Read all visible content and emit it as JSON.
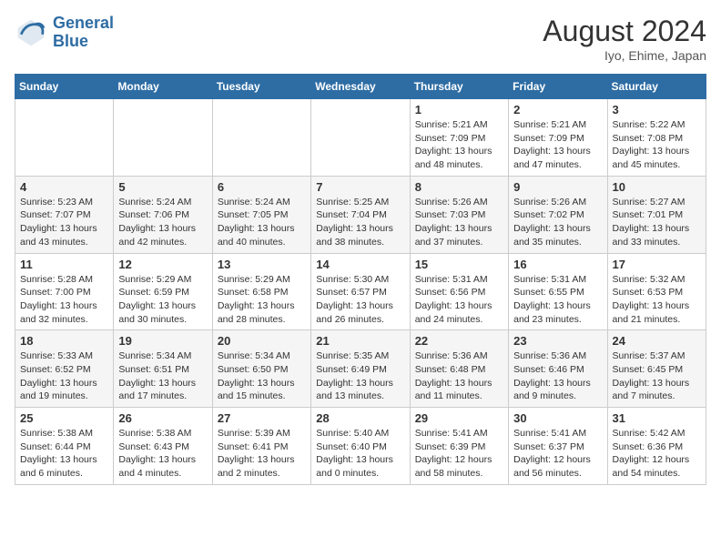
{
  "header": {
    "logo_line1": "General",
    "logo_line2": "Blue",
    "month": "August 2024",
    "location": "Iyo, Ehime, Japan"
  },
  "weekdays": [
    "Sunday",
    "Monday",
    "Tuesday",
    "Wednesday",
    "Thursday",
    "Friday",
    "Saturday"
  ],
  "weeks": [
    [
      {
        "day": "",
        "info": ""
      },
      {
        "day": "",
        "info": ""
      },
      {
        "day": "",
        "info": ""
      },
      {
        "day": "",
        "info": ""
      },
      {
        "day": "1",
        "info": "Sunrise: 5:21 AM\nSunset: 7:09 PM\nDaylight: 13 hours\nand 48 minutes."
      },
      {
        "day": "2",
        "info": "Sunrise: 5:21 AM\nSunset: 7:09 PM\nDaylight: 13 hours\nand 47 minutes."
      },
      {
        "day": "3",
        "info": "Sunrise: 5:22 AM\nSunset: 7:08 PM\nDaylight: 13 hours\nand 45 minutes."
      }
    ],
    [
      {
        "day": "4",
        "info": "Sunrise: 5:23 AM\nSunset: 7:07 PM\nDaylight: 13 hours\nand 43 minutes."
      },
      {
        "day": "5",
        "info": "Sunrise: 5:24 AM\nSunset: 7:06 PM\nDaylight: 13 hours\nand 42 minutes."
      },
      {
        "day": "6",
        "info": "Sunrise: 5:24 AM\nSunset: 7:05 PM\nDaylight: 13 hours\nand 40 minutes."
      },
      {
        "day": "7",
        "info": "Sunrise: 5:25 AM\nSunset: 7:04 PM\nDaylight: 13 hours\nand 38 minutes."
      },
      {
        "day": "8",
        "info": "Sunrise: 5:26 AM\nSunset: 7:03 PM\nDaylight: 13 hours\nand 37 minutes."
      },
      {
        "day": "9",
        "info": "Sunrise: 5:26 AM\nSunset: 7:02 PM\nDaylight: 13 hours\nand 35 minutes."
      },
      {
        "day": "10",
        "info": "Sunrise: 5:27 AM\nSunset: 7:01 PM\nDaylight: 13 hours\nand 33 minutes."
      }
    ],
    [
      {
        "day": "11",
        "info": "Sunrise: 5:28 AM\nSunset: 7:00 PM\nDaylight: 13 hours\nand 32 minutes."
      },
      {
        "day": "12",
        "info": "Sunrise: 5:29 AM\nSunset: 6:59 PM\nDaylight: 13 hours\nand 30 minutes."
      },
      {
        "day": "13",
        "info": "Sunrise: 5:29 AM\nSunset: 6:58 PM\nDaylight: 13 hours\nand 28 minutes."
      },
      {
        "day": "14",
        "info": "Sunrise: 5:30 AM\nSunset: 6:57 PM\nDaylight: 13 hours\nand 26 minutes."
      },
      {
        "day": "15",
        "info": "Sunrise: 5:31 AM\nSunset: 6:56 PM\nDaylight: 13 hours\nand 24 minutes."
      },
      {
        "day": "16",
        "info": "Sunrise: 5:31 AM\nSunset: 6:55 PM\nDaylight: 13 hours\nand 23 minutes."
      },
      {
        "day": "17",
        "info": "Sunrise: 5:32 AM\nSunset: 6:53 PM\nDaylight: 13 hours\nand 21 minutes."
      }
    ],
    [
      {
        "day": "18",
        "info": "Sunrise: 5:33 AM\nSunset: 6:52 PM\nDaylight: 13 hours\nand 19 minutes."
      },
      {
        "day": "19",
        "info": "Sunrise: 5:34 AM\nSunset: 6:51 PM\nDaylight: 13 hours\nand 17 minutes."
      },
      {
        "day": "20",
        "info": "Sunrise: 5:34 AM\nSunset: 6:50 PM\nDaylight: 13 hours\nand 15 minutes."
      },
      {
        "day": "21",
        "info": "Sunrise: 5:35 AM\nSunset: 6:49 PM\nDaylight: 13 hours\nand 13 minutes."
      },
      {
        "day": "22",
        "info": "Sunrise: 5:36 AM\nSunset: 6:48 PM\nDaylight: 13 hours\nand 11 minutes."
      },
      {
        "day": "23",
        "info": "Sunrise: 5:36 AM\nSunset: 6:46 PM\nDaylight: 13 hours\nand 9 minutes."
      },
      {
        "day": "24",
        "info": "Sunrise: 5:37 AM\nSunset: 6:45 PM\nDaylight: 13 hours\nand 7 minutes."
      }
    ],
    [
      {
        "day": "25",
        "info": "Sunrise: 5:38 AM\nSunset: 6:44 PM\nDaylight: 13 hours\nand 6 minutes."
      },
      {
        "day": "26",
        "info": "Sunrise: 5:38 AM\nSunset: 6:43 PM\nDaylight: 13 hours\nand 4 minutes."
      },
      {
        "day": "27",
        "info": "Sunrise: 5:39 AM\nSunset: 6:41 PM\nDaylight: 13 hours\nand 2 minutes."
      },
      {
        "day": "28",
        "info": "Sunrise: 5:40 AM\nSunset: 6:40 PM\nDaylight: 13 hours\nand 0 minutes."
      },
      {
        "day": "29",
        "info": "Sunrise: 5:41 AM\nSunset: 6:39 PM\nDaylight: 12 hours\nand 58 minutes."
      },
      {
        "day": "30",
        "info": "Sunrise: 5:41 AM\nSunset: 6:37 PM\nDaylight: 12 hours\nand 56 minutes."
      },
      {
        "day": "31",
        "info": "Sunrise: 5:42 AM\nSunset: 6:36 PM\nDaylight: 12 hours\nand 54 minutes."
      }
    ]
  ]
}
